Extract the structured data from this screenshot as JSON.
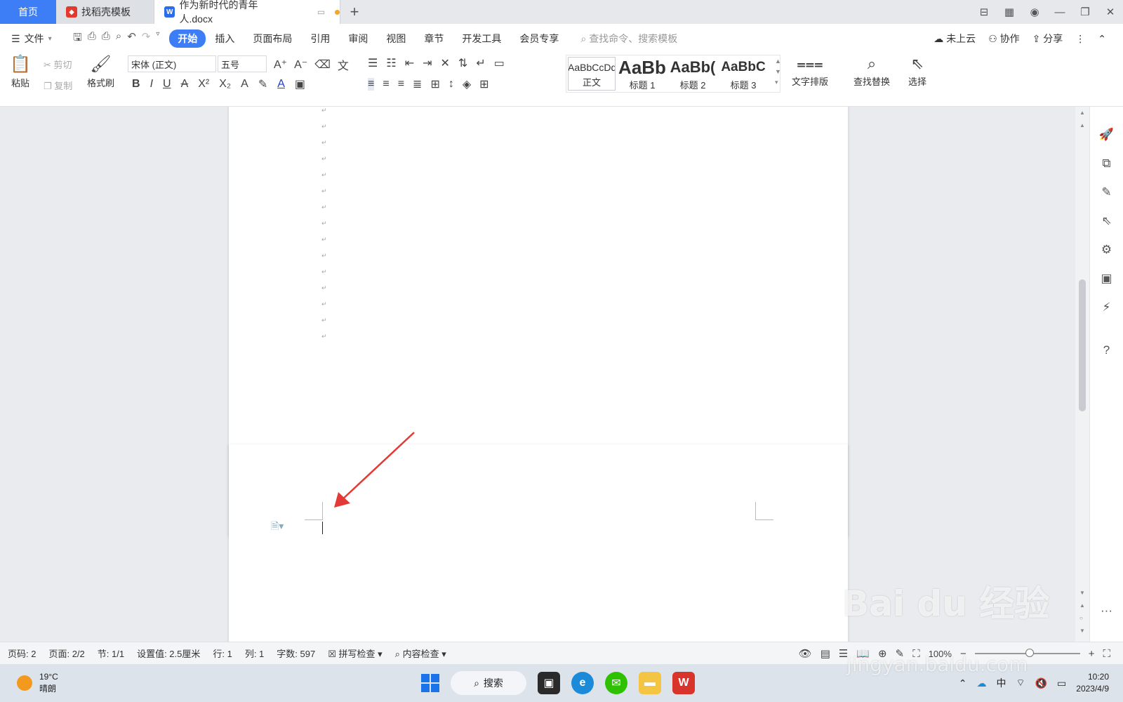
{
  "tabs": {
    "home": "首页",
    "template": "找稻壳模板",
    "doc": "作为新时代的青年人.docx"
  },
  "menubar": {
    "file": "文件",
    "menus": [
      "开始",
      "插入",
      "页面布局",
      "引用",
      "审阅",
      "视图",
      "章节",
      "开发工具",
      "会员专享"
    ],
    "search_placeholder": "查找命令、搜索模板",
    "cloud": "未上云",
    "collab": "协作",
    "share": "分享"
  },
  "ribbon": {
    "paste": "粘贴",
    "cut": "剪切",
    "copy": "复制",
    "format_painter": "格式刷",
    "font_name": "宋体 (正文)",
    "font_size": "五号",
    "styles": [
      {
        "sample": "AaBbCcDd",
        "name": "正文"
      },
      {
        "sample": "AaBb",
        "name": "标题 1"
      },
      {
        "sample": "AaBb(",
        "name": "标题 2"
      },
      {
        "sample": "AaBbC",
        "name": "标题 3"
      }
    ],
    "text_layout": "文字排版",
    "find_replace": "查找替换",
    "select": "选择"
  },
  "statusbar": {
    "page_no": "页码: 2",
    "pages": "页面: 2/2",
    "section": "节: 1/1",
    "setting": "设置值: 2.5厘米",
    "row": "行: 1",
    "col": "列: 1",
    "word_count": "字数: 597",
    "spell_check": "拼写检查",
    "content_check": "内容检查",
    "zoom": "100%"
  },
  "taskbar": {
    "temp": "19°C",
    "weather": "晴朗",
    "search": "搜索",
    "ime": "中",
    "time": "10:20",
    "date": "2023/4/9"
  },
  "watermark": {
    "brand": "Bai du 经验",
    "url": "jingyan.baidu.com"
  },
  "colors": {
    "accent": "#3d7ef6",
    "arrow": "#e53935",
    "wps_red": "#d9342b"
  },
  "icons": [
    "menu-icon",
    "save-icon",
    "print-icon",
    "undo-icon",
    "redo-icon",
    "search-icon",
    "cloud-icon",
    "collab-icon",
    "share-icon",
    "paste-icon",
    "scissors-icon",
    "copy-icon",
    "brush-icon",
    "bold-icon",
    "italic-icon",
    "underline-icon",
    "align-left-icon",
    "find-icon",
    "cursor-icon",
    "help-icon",
    "eye-icon",
    "windows-logo-icon",
    "edge-icon",
    "wechat-icon",
    "folder-icon",
    "wps-icon",
    "wifi-icon",
    "volume-icon",
    "battery-icon"
  ]
}
